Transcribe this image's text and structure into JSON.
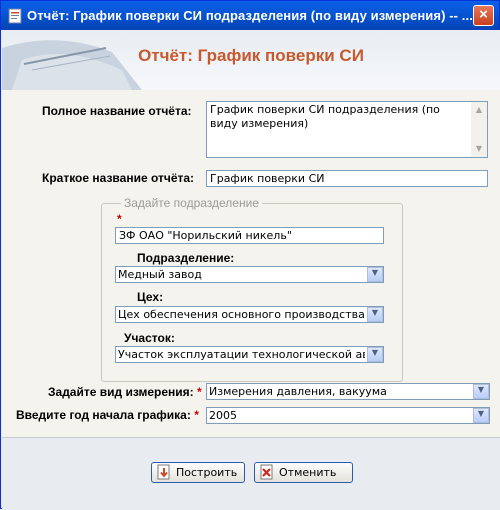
{
  "window": {
    "title": "Отчёт: График поверки СИ подразделения (по виду измерения) -- ...",
    "close_glyph": "×"
  },
  "header": {
    "title": "Отчёт: График поверки СИ"
  },
  "form": {
    "full_name_label": "Полное название отчёта:",
    "full_name_value": "График поверки СИ подразделения (по виду измерения)",
    "short_name_label": "Краткое название отчёта:",
    "short_name_value": "График поверки СИ",
    "group_legend": "Задайте подразделение",
    "required_mark": "*",
    "company_value": "ЗФ ОАО \"Норильский никель\"",
    "division_label": "Подразделение:",
    "division_value": "Медный завод",
    "shop_label": "Цех:",
    "shop_value": "Цех обеспечения основного производства",
    "section_label": "Участок:",
    "section_value": "Участок эксплуатации технологической автоматики",
    "measure_label": "Задайте вид измерения:",
    "measure_value": "Измерения давления, вакуума",
    "year_label": "Введите год начала графика:",
    "year_value": "2005"
  },
  "buttons": {
    "build": "Построить",
    "cancel": "Отменить"
  },
  "colors": {
    "accent": "#c65a2e",
    "titlebar": "#0756d6",
    "required": "#d00000"
  }
}
